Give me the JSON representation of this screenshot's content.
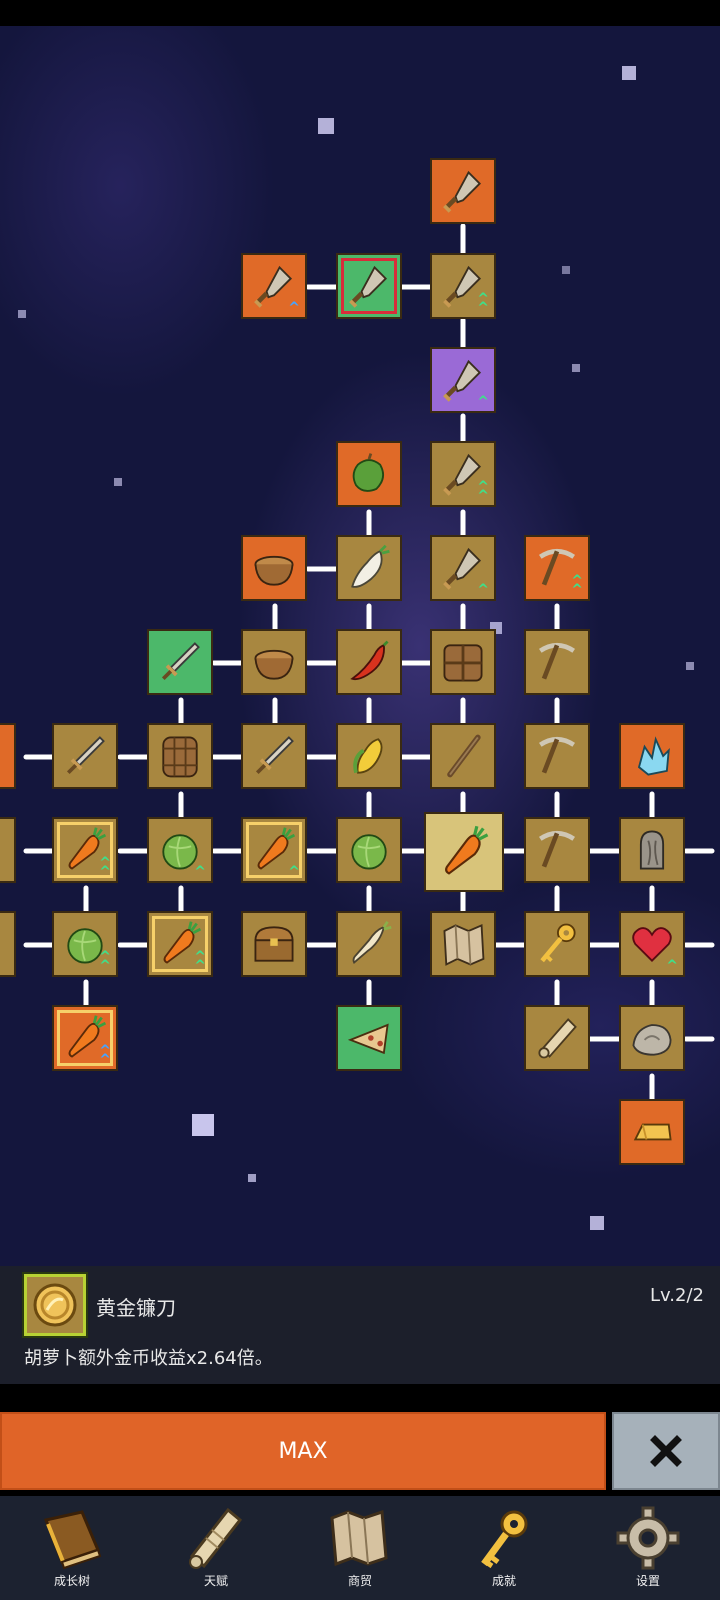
{
  "info_panel": {
    "item_name": "黄金镰刀",
    "level": "Lv.2/2",
    "description": "胡萝卜额外金币收益x2.64倍。",
    "icon": "golden-coin-icon"
  },
  "actions": {
    "max_label": "MAX",
    "close_icon": "close-x-icon"
  },
  "bottom_nav": [
    {
      "label": "成长树",
      "icon": "book-icon"
    },
    {
      "label": "天赋",
      "icon": "scroll-icon"
    },
    {
      "label": "商贸",
      "icon": "map-icon"
    },
    {
      "label": "成就",
      "icon": "key-icon"
    },
    {
      "label": "设置",
      "icon": "gear-icon"
    }
  ],
  "tree_nodes": [
    {
      "icon": "shovel-icon",
      "frame": "orange"
    },
    {
      "icon": "shovel-icon",
      "frame": "orange"
    },
    {
      "icon": "shovel-icon",
      "frame": "green"
    },
    {
      "icon": "shovel-icon",
      "frame": "brown"
    },
    {
      "icon": "shovel-icon",
      "frame": "purple"
    },
    {
      "icon": "pepper-icon",
      "frame": "orange"
    },
    {
      "icon": "shovel-icon",
      "frame": "brown"
    },
    {
      "icon": "bowl-icon",
      "frame": "orange"
    },
    {
      "icon": "radish-icon",
      "frame": "brown"
    },
    {
      "icon": "shovel-icon",
      "frame": "brown"
    },
    {
      "icon": "pickaxe-icon",
      "frame": "orange"
    },
    {
      "icon": "sword-icon",
      "frame": "green"
    },
    {
      "icon": "bowl-icon",
      "frame": "brown"
    },
    {
      "icon": "chili-icon",
      "frame": "brown"
    },
    {
      "icon": "crate-icon",
      "frame": "brown"
    },
    {
      "icon": "pickaxe-icon",
      "frame": "brown"
    },
    {
      "icon": "sword-icon",
      "frame": "brown"
    },
    {
      "icon": "barrel-icon",
      "frame": "brown"
    },
    {
      "icon": "sword-icon",
      "frame": "brown"
    },
    {
      "icon": "corn-icon",
      "frame": "brown"
    },
    {
      "icon": "stick-icon",
      "frame": "brown"
    },
    {
      "icon": "pickaxe-icon",
      "frame": "brown"
    },
    {
      "icon": "crystal-icon",
      "frame": "orange"
    },
    {
      "icon": "carrot-icon",
      "frame": "brown"
    },
    {
      "icon": "cabbage-icon",
      "frame": "brown"
    },
    {
      "icon": "carrot-icon",
      "frame": "brown"
    },
    {
      "icon": "cabbage-icon",
      "frame": "brown"
    },
    {
      "icon": "carrot-icon",
      "frame": "brown"
    },
    {
      "icon": "pickaxe-icon",
      "frame": "brown"
    },
    {
      "icon": "statue-icon",
      "frame": "brown"
    },
    {
      "icon": "cabbage-icon",
      "frame": "brown"
    },
    {
      "icon": "carrot-icon",
      "frame": "brown"
    },
    {
      "icon": "chest-icon",
      "frame": "brown"
    },
    {
      "icon": "parsnip-icon",
      "frame": "brown"
    },
    {
      "icon": "map-icon",
      "frame": "brown"
    },
    {
      "icon": "key-icon",
      "frame": "brown"
    },
    {
      "icon": "heart-icon",
      "frame": "brown"
    },
    {
      "icon": "carrot-icon",
      "frame": "orange"
    },
    {
      "icon": "pizza-icon",
      "frame": "green"
    },
    {
      "icon": "scroll-icon",
      "frame": "brown"
    },
    {
      "icon": "rock-icon",
      "frame": "brown"
    },
    {
      "icon": "gold-bar-icon",
      "frame": "orange"
    }
  ]
}
